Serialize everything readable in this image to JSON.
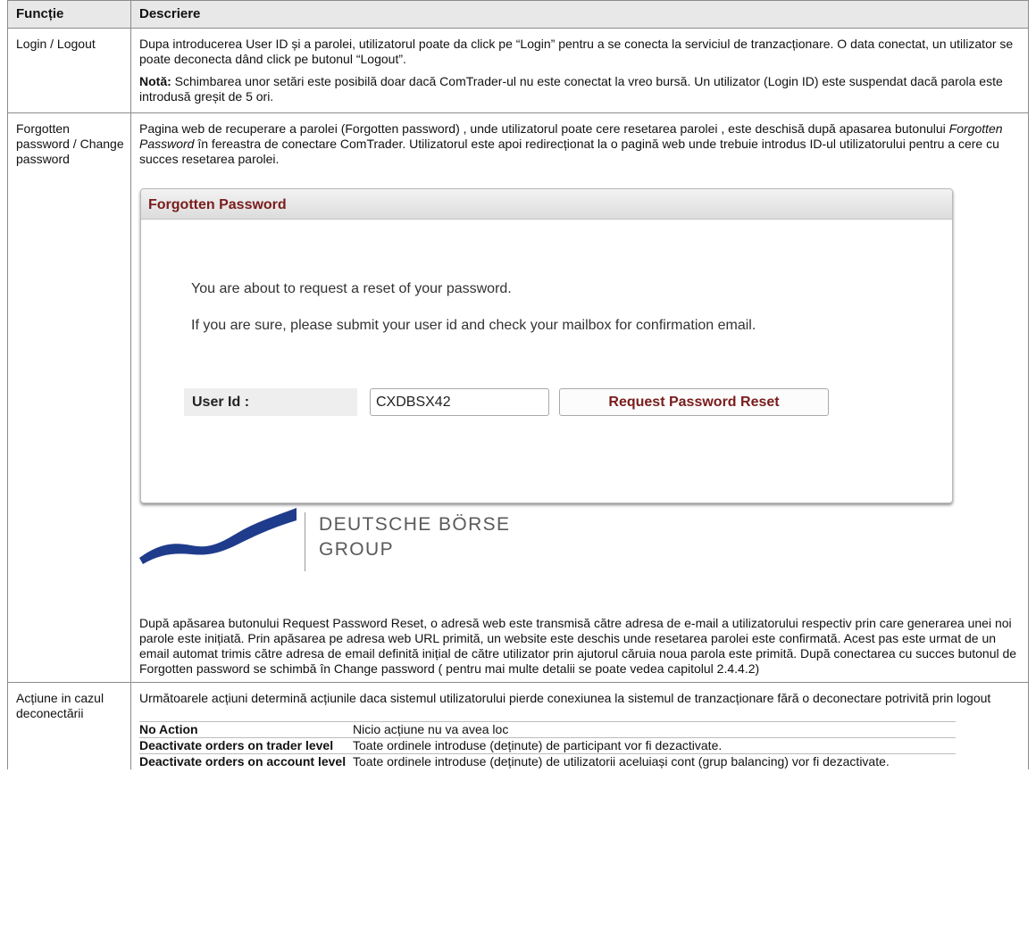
{
  "table": {
    "headers": {
      "function": "Funcție",
      "description": "Descriere"
    },
    "rows": {
      "login": {
        "function": "Login / Logout",
        "desc1": "Dupa introducerea User ID și a parolei, utilizatorul poate da click pe “Login” pentru a se conecta la serviciul de tranzacționare. O data conectat, un utilizator se poate deconecta dând click pe butonul “Logout”.",
        "note_label": "Notă:",
        "note_text": " Schimbarea unor setări este posibilă doar dacă ComTrader-ul nu este conectat la vreo bursă. Un utilizator (Login ID) este suspendat dacă parola este introdusă greșit de 5 ori."
      },
      "forgotten": {
        "function": "Forgotten password / Change password",
        "desc_a": "Pagina web de recuperare a parolei (Forgotten password) , unde utilizatorul poate cere resetarea parolei , este deschisă după apasarea butonului ",
        "desc_italic": "Forgotten Password",
        "desc_b": " în fereastra de conectare ComTrader. Utilizatorul este apoi redirecționat la o pagină web unde trebuie introdus ID-ul utilizatorului pentru a cere cu succes resetarea parolei.",
        "desc_after": "După apăsarea butonului Request Password Reset, o adresă web este transmisă către adresa de e-mail a utilizatorului respectiv prin care generarea unei noi parole este inițiată. Prin apăsarea pe adresa web URL primită, un website este deschis unde resetarea parolei este confirmată. Acest pas este urmat de un email automat trimis către adresa de email definită inițial de către utilizator prin ajutorul căruia noua parola este primită. După conectarea cu succes butonul de Forgotten password se schimbă în Change password ( pentru mai multe detalii se poate vedea capitolul 2.4.4.2)"
      },
      "disconnect": {
        "function": "Acțiune in cazul deconectării",
        "desc": "Următoarele acțiuni determină acțiunile daca sistemul utilizatorului pierde conexiunea la sistemul de tranzacționare fără o deconectare potrivită prin logout",
        "options": [
          {
            "name": "No Action",
            "desc": "Nicio acțiune nu va avea loc"
          },
          {
            "name": "Deactivate orders on trader level",
            "desc": "Toate ordinele introduse (deținute) de participant vor fi dezactivate."
          },
          {
            "name": "Deactivate orders on account level",
            "desc": "Toate ordinele introduse (deținute) de utilizatorii aceluiași cont (grup balancing) vor fi dezactivate."
          }
        ]
      }
    }
  },
  "dialog": {
    "title": "Forgotten Password",
    "line1": "You are about to request a reset of your password.",
    "line2": "If you are sure, please submit your user id and check your mailbox for confirmation email.",
    "user_label": "User Id :",
    "user_value": "CXDBSX42",
    "button_label": "Request Password Reset"
  },
  "logo": {
    "line1": "DEUTSCHE BÖRSE",
    "line2": "GROUP",
    "color": "#1f3c8c"
  }
}
